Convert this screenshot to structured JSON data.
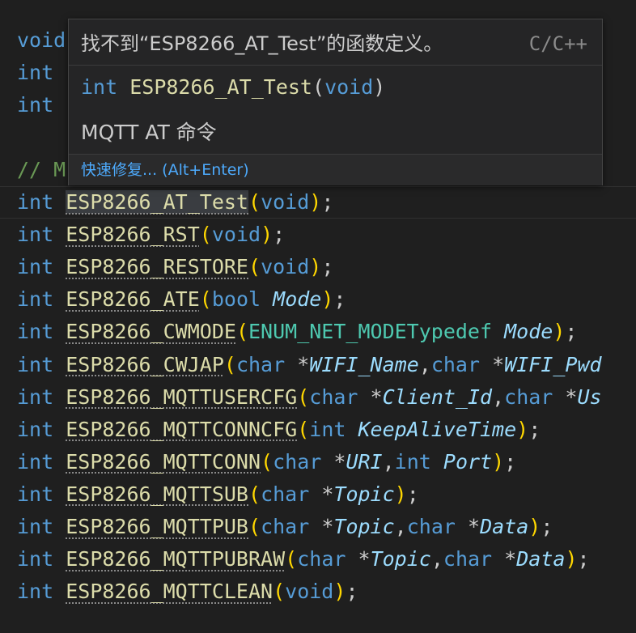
{
  "background": "#1f1f1f",
  "colors": {
    "keyword": "#569cd6",
    "function": "#dcdcaa",
    "parameter": "#9cdcfe",
    "type": "#4ec9b0",
    "bracket": "#ffd700",
    "comment": "#6a9955",
    "link": "#4daafc"
  },
  "code": {
    "hidden_top": [
      "void",
      "int",
      "int"
    ],
    "comment_prefix": "// M",
    "semicolon": ";",
    "lines": [
      {
        "ret": "int",
        "name": "ESP8266_AT_Test",
        "params": [
          {
            "kw": "void"
          }
        ]
      },
      {
        "ret": "int",
        "name": "ESP8266_RST",
        "params": [
          {
            "kw": "void"
          }
        ]
      },
      {
        "ret": "int",
        "name": "ESP8266_RESTORE",
        "params": [
          {
            "kw": "void"
          }
        ]
      },
      {
        "ret": "int",
        "name": "ESP8266_ATE",
        "params": [
          {
            "kw": "bool",
            "p": "Mode"
          }
        ]
      },
      {
        "ret": "int",
        "name": "ESP8266_CWMODE",
        "params": [
          {
            "type": "ENUM_NET_MODETypedef",
            "p": "Mode"
          }
        ]
      },
      {
        "ret": "int",
        "name": "ESP8266_CWJAP",
        "params": [
          {
            "kw": "char",
            "ptr": "*",
            "p": "WIFI_Name"
          },
          {
            "kw": "char",
            "ptr": "*",
            "p": "WIFI_Pwd"
          }
        ]
      },
      {
        "ret": "int",
        "name": "ESP8266_MQTTUSERCFG",
        "params": [
          {
            "kw": "char",
            "ptr": "*",
            "p": "Client_Id"
          },
          {
            "kw": "char",
            "ptr": "*",
            "p": "Us"
          }
        ]
      },
      {
        "ret": "int",
        "name": "ESP8266_MQTTCONNCFG",
        "params": [
          {
            "kw": "int",
            "p": "KeepAliveTime"
          }
        ]
      },
      {
        "ret": "int",
        "name": "ESP8266_MQTTCONN",
        "params": [
          {
            "kw": "char",
            "ptr": "*",
            "p": "URI"
          },
          {
            "kw": "int",
            "p": "Port"
          }
        ]
      },
      {
        "ret": "int",
        "name": "ESP8266_MQTTSUB",
        "params": [
          {
            "kw": "char",
            "ptr": "*",
            "p": "Topic"
          }
        ]
      },
      {
        "ret": "int",
        "name": "ESP8266_MQTTPUB",
        "params": [
          {
            "kw": "char",
            "ptr": "*",
            "p": "Topic"
          },
          {
            "kw": "char",
            "ptr": "*",
            "p": "Data"
          }
        ]
      },
      {
        "ret": "int",
        "name": "ESP8266_MQTTPUBRAW",
        "params": [
          {
            "kw": "char",
            "ptr": "*",
            "p": "Topic"
          },
          {
            "kw": "char",
            "ptr": "*",
            "p": "Data"
          }
        ]
      },
      {
        "ret": "int",
        "name": "ESP8266_MQTTCLEAN",
        "params": [
          {
            "kw": "void"
          }
        ]
      }
    ]
  },
  "hover": {
    "message": "找不到“ESP8266_AT_Test”的函数定义。",
    "source": "C/C++",
    "signature": {
      "ret": "int",
      "name": "ESP8266_AT_Test",
      "open": "(",
      "param": "void",
      "close": ")"
    },
    "doc": "MQTT AT 命令",
    "quick_fix": "快速修复... (Alt+Enter)"
  }
}
